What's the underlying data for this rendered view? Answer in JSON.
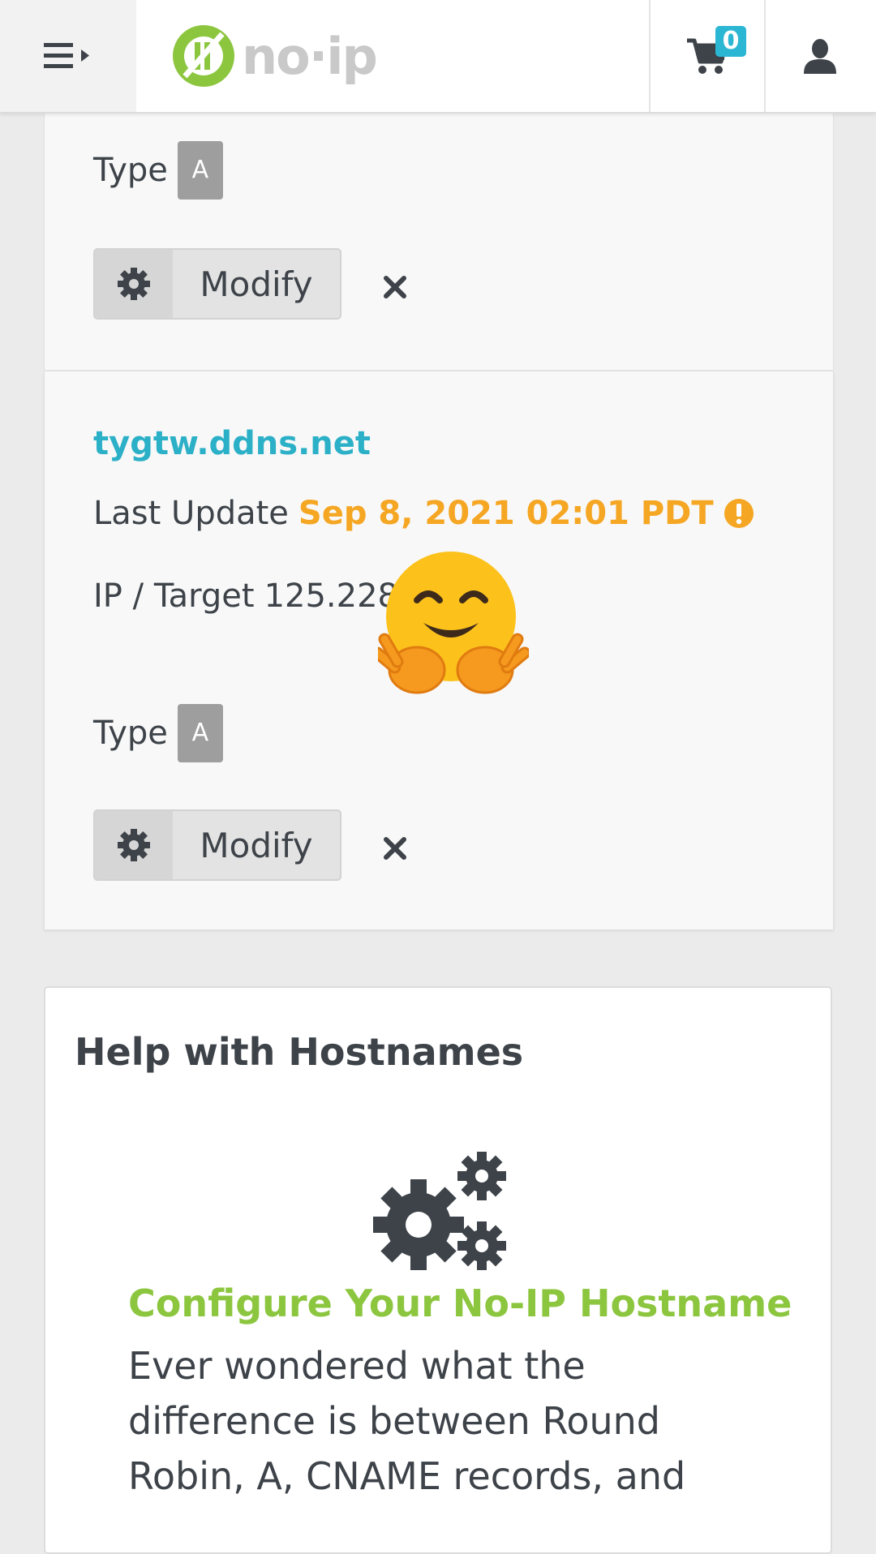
{
  "header": {
    "logo_text": "no·ip",
    "cart_count": "0"
  },
  "host_cards": [
    {
      "type_label": "Type",
      "type_value": "A",
      "modify_label": "Modify"
    },
    {
      "hostname": "tygtw.ddns.net",
      "last_update_label": "Last Update",
      "last_update_value": "Sep 8, 2021 02:01 PDT",
      "ip_label": "IP / Target",
      "ip_value": "125.228",
      "type_label": "Type",
      "type_value": "A",
      "modify_label": "Modify"
    }
  ],
  "help": {
    "title": "Help with Hostnames",
    "subtitle": "Configure Your No-IP Hostname",
    "body": "Ever wondered what the difference is between Round Robin, A, CNAME records, and"
  },
  "colors": {
    "link": "#2bb0c7",
    "warning": "#f5a623",
    "brand_green": "#8cc63f",
    "badge": "#2bb6d3"
  },
  "icons": [
    "menu-icon",
    "cart-icon",
    "user-icon",
    "gear-icon",
    "close-icon",
    "warning-icon",
    "gears-icon",
    "hugging-face-emoji"
  ]
}
